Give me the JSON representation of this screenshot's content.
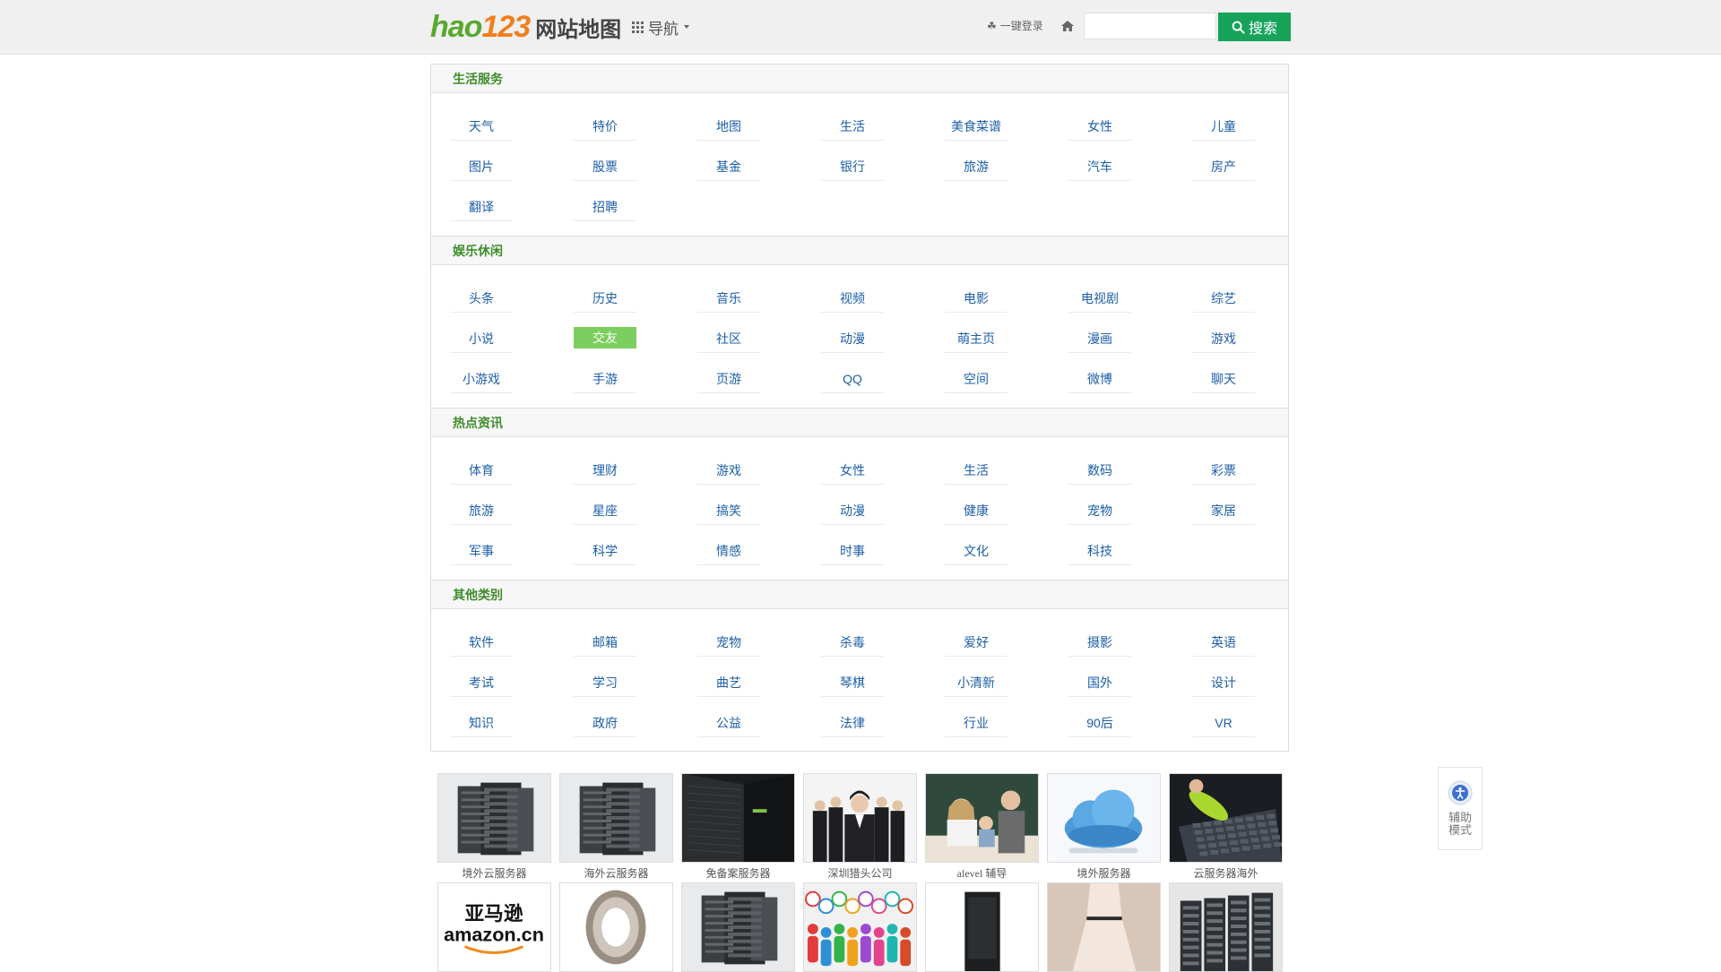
{
  "header": {
    "logo_hao": "hao",
    "logo_123": "123",
    "logo_text": "网站地图",
    "nav_label": "导航",
    "login_label": "一键登录",
    "search_placeholder": "",
    "search_button": "搜索"
  },
  "sections": [
    {
      "title": "生活服务",
      "links": [
        "天气",
        "特价",
        "地图",
        "生活",
        "美食菜谱",
        "女性",
        "儿童",
        "图片",
        "股票",
        "基金",
        "银行",
        "旅游",
        "汽车",
        "房产",
        "翻译",
        "招聘"
      ]
    },
    {
      "title": "娱乐休闲",
      "links": [
        "头条",
        "历史",
        "音乐",
        "视频",
        "电影",
        "电视剧",
        "综艺",
        "小说",
        "交友",
        "社区",
        "动漫",
        "萌主页",
        "漫画",
        "游戏",
        "小游戏",
        "手游",
        "页游",
        "QQ",
        "空间",
        "微博",
        "聊天"
      ],
      "active_link": "交友"
    },
    {
      "title": "热点资讯",
      "links": [
        "体育",
        "理财",
        "游戏",
        "女性",
        "生活",
        "数码",
        "彩票",
        "旅游",
        "星座",
        "搞笑",
        "动漫",
        "健康",
        "宠物",
        "家居",
        "军事",
        "科学",
        "情感",
        "时事",
        "文化",
        "科技"
      ]
    },
    {
      "title": "其他类别",
      "links": [
        "软件",
        "邮箱",
        "宠物",
        "杀毒",
        "爱好",
        "摄影",
        "英语",
        "考试",
        "学习",
        "曲艺",
        "琴棋",
        "小清新",
        "国外",
        "设计",
        "知识",
        "政府",
        "公益",
        "法律",
        "行业",
        "90后",
        "VR"
      ]
    }
  ],
  "image_ads_row1": [
    {
      "caption": "境外云服务器",
      "icon": "server-rack-image"
    },
    {
      "caption": "海外云服务器",
      "icon": "server-rack-image"
    },
    {
      "caption": "免备案服务器",
      "icon": "dark-server-image"
    },
    {
      "caption": "深圳猎头公司",
      "icon": "business-people-image"
    },
    {
      "caption": "alevel 辅导",
      "icon": "classroom-image"
    },
    {
      "caption": "境外服务器",
      "icon": "cloud-image"
    },
    {
      "caption": "云服务器海外",
      "icon": "keyboard-cleaning-image"
    }
  ],
  "image_ads_row2": [
    {
      "logo_cn": "亚马逊",
      "logo_en": "amazon.cn",
      "icon": "amazon-logo-image"
    },
    {
      "icon": "bearing-image"
    },
    {
      "icon": "server-rack-image"
    },
    {
      "icon": "people-figures-image"
    },
    {
      "icon": "tower-server-image"
    },
    {
      "icon": "dress-image"
    },
    {
      "icon": "server-cabinet-image"
    }
  ],
  "aux": {
    "label": "辅助模式"
  },
  "colors": {
    "accent_green": "#17a35a",
    "section_title": "#3e8c2c",
    "link_blue": "#1d5fa7",
    "active_link_bg": "#7ccf5e"
  }
}
